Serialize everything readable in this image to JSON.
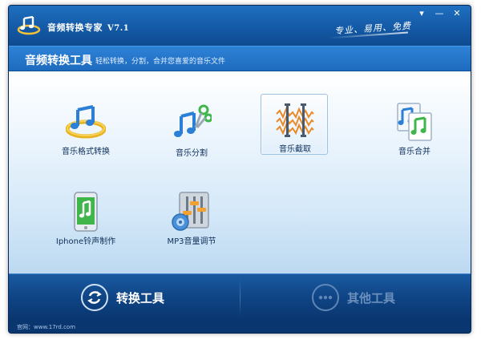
{
  "window": {
    "title": "音频转换专家",
    "version": "V7.1",
    "slogan": "专业、易用、免费"
  },
  "window_controls": {
    "menu": "▾",
    "minimize": "—",
    "close": "✕"
  },
  "header": {
    "section_title": "音频转换工具",
    "section_desc": "轻松转换，分割，合并您喜爱的音乐文件"
  },
  "tools": [
    {
      "label": "音乐格式转换",
      "icon": "music-convert-icon",
      "selected": false
    },
    {
      "label": "音乐分割",
      "icon": "music-split-icon",
      "selected": false
    },
    {
      "label": "音乐截取",
      "icon": "music-cut-icon",
      "selected": true
    },
    {
      "label": "音乐合并",
      "icon": "music-merge-icon",
      "selected": false
    },
    {
      "label": "Iphone铃声制作",
      "icon": "iphone-ringtone-icon",
      "selected": false
    },
    {
      "label": "MP3音量调节",
      "icon": "mp3-volume-icon",
      "selected": false
    }
  ],
  "bottom_tabs": [
    {
      "label": "转换工具",
      "icon": "refresh-circle-icon",
      "active": true
    },
    {
      "label": "其他工具",
      "icon": "more-circle-icon",
      "active": false
    }
  ],
  "status": {
    "website": "官网：www.17rd.com"
  },
  "colors": {
    "titlebar": "#145aa6",
    "bottombar": "#0f4585",
    "content_top": "#ffffff",
    "content_bottom": "#bcd9f1",
    "label_text": "#0e2f5a",
    "music_green": "#3fb54a",
    "music_blue": "#2b7fd6"
  }
}
